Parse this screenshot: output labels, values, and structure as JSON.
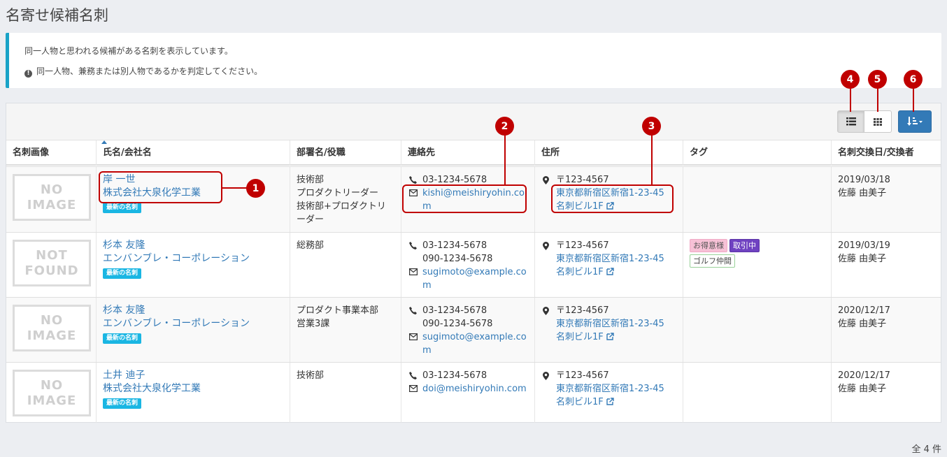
{
  "page": {
    "title": "名寄せ候補名刺",
    "info_line1": "同一人物と思われる候補がある名刺を表示しています。",
    "info_line2": "同一人物、兼務または別人物であるかを判定してください。",
    "total_count": "全 4 件"
  },
  "table": {
    "headers": {
      "image": "名刺画像",
      "name": "氏名/会社名",
      "dept": "部署名/役職",
      "contact": "連絡先",
      "address": "住所",
      "tag": "タグ",
      "exchange": "名刺交換日/交換者"
    },
    "rows": [
      {
        "img_line1": "NO",
        "img_line2": "IMAGE",
        "name": "岸 一世",
        "company": "株式会社大泉化学工業",
        "badge": "最新の名刺",
        "dept_lines": [
          "技術部",
          "プロダクトリーダー",
          "技術部+プロダクトリ",
          "ーダー"
        ],
        "phone": "03-1234-5678",
        "mobile": "",
        "email_line1": "kishi@meishiryohin.co",
        "email_line2": "m",
        "postal": "〒123-4567",
        "addr1": "東京都新宿区新宿1-23-45",
        "addr2": "名刺ビル1F",
        "tags": [],
        "date": "2019/03/18",
        "person": "佐藤 由美子"
      },
      {
        "img_line1": "NOT",
        "img_line2": "FOUND",
        "name": "杉本 友隆",
        "company": "エンバンブレ・コーポレーション",
        "badge": "最新の名刺",
        "dept_lines": [
          "総務部"
        ],
        "phone": "03-1234-5678",
        "mobile": "090-1234-5678",
        "email_line1": "sugimoto@example.co",
        "email_line2": "m",
        "postal": "〒123-4567",
        "addr1": "東京都新宿区新宿1-23-45",
        "addr2": "名刺ビル1F",
        "tags": [
          "お得意様",
          "取引中",
          "ゴルフ仲間"
        ],
        "date": "2019/03/19",
        "person": "佐藤 由美子"
      },
      {
        "img_line1": "NO",
        "img_line2": "IMAGE",
        "name": "杉本 友隆",
        "company": "エンバンブレ・コーポレーション",
        "badge": "最新の名刺",
        "dept_lines": [
          "プロダクト事業本部",
          "営業3課"
        ],
        "phone": "03-1234-5678",
        "mobile": "090-1234-5678",
        "email_line1": "sugimoto@example.co",
        "email_line2": "m",
        "postal": "〒123-4567",
        "addr1": "東京都新宿区新宿1-23-45",
        "addr2": "名刺ビル1F",
        "tags": [],
        "date": "2020/12/17",
        "person": "佐藤 由美子"
      },
      {
        "img_line1": "NO",
        "img_line2": "IMAGE",
        "name": "土井 迪子",
        "company": "株式会社大泉化学工業",
        "badge": "最新の名刺",
        "dept_lines": [
          "技術部"
        ],
        "phone": "03-1234-5678",
        "mobile": "",
        "email_line1": "doi@meishiryohin.com",
        "email_line2": "",
        "postal": "〒123-4567",
        "addr1": "東京都新宿区新宿1-23-45",
        "addr2": "名刺ビル1F",
        "tags": [],
        "date": "2020/12/17",
        "person": "佐藤 由美子"
      }
    ]
  },
  "callouts": [
    "1",
    "2",
    "3",
    "4",
    "5",
    "6"
  ],
  "colors": {
    "accent": "#337ab7",
    "callout": "#c00000",
    "info_border": "#1aa3c7"
  }
}
